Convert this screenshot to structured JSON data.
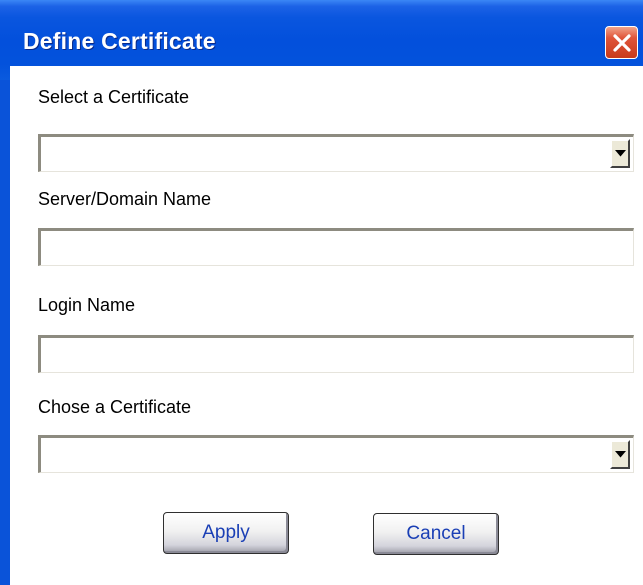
{
  "window": {
    "title": "Define Certificate",
    "close_icon": "close-icon"
  },
  "form": {
    "select_certificate": {
      "label": "Select a Certificate",
      "value": ""
    },
    "server_domain": {
      "label": "Server/Domain Name",
      "value": ""
    },
    "login_name": {
      "label": "Login Name",
      "value": ""
    },
    "choose_certificate": {
      "label": "Chose a Certificate",
      "value": ""
    }
  },
  "buttons": {
    "apply": "Apply",
    "cancel": "Cancel"
  },
  "colors": {
    "titlebar": "#0352dc",
    "close": "#e0553a",
    "button_text": "#1a3fb5"
  }
}
